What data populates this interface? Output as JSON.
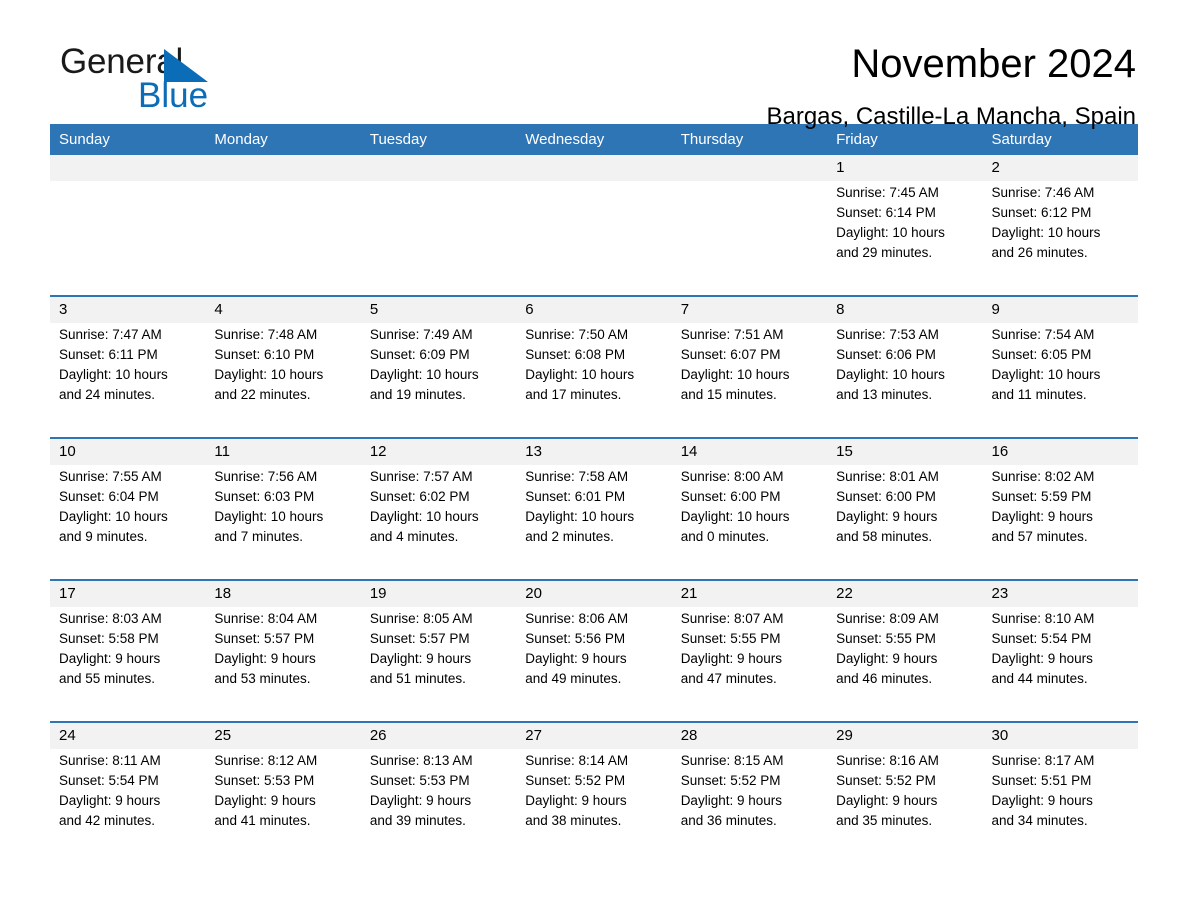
{
  "brand": {
    "name_part1": "General",
    "name_part2": "Blue",
    "triangle_icon": "triangle-icon",
    "accent_color": "#0b6cb7"
  },
  "header": {
    "title": "November 2024",
    "subtitle": "Bargas, Castille-La Mancha, Spain"
  },
  "theme": {
    "header_blue": "#2e75b6",
    "daynum_band": "#f2f2f2",
    "cell_background": "#ffffff"
  },
  "calendar": {
    "weekdays": [
      "Sunday",
      "Monday",
      "Tuesday",
      "Wednesday",
      "Thursday",
      "Friday",
      "Saturday"
    ],
    "weeks": [
      {
        "days": [
          {
            "num": "",
            "sunrise": "",
            "sunset": "",
            "daylight1": "",
            "daylight2": ""
          },
          {
            "num": "",
            "sunrise": "",
            "sunset": "",
            "daylight1": "",
            "daylight2": ""
          },
          {
            "num": "",
            "sunrise": "",
            "sunset": "",
            "daylight1": "",
            "daylight2": ""
          },
          {
            "num": "",
            "sunrise": "",
            "sunset": "",
            "daylight1": "",
            "daylight2": ""
          },
          {
            "num": "",
            "sunrise": "",
            "sunset": "",
            "daylight1": "",
            "daylight2": ""
          },
          {
            "num": "1",
            "sunrise": "Sunrise: 7:45 AM",
            "sunset": "Sunset: 6:14 PM",
            "daylight1": "Daylight: 10 hours",
            "daylight2": "and 29 minutes."
          },
          {
            "num": "2",
            "sunrise": "Sunrise: 7:46 AM",
            "sunset": "Sunset: 6:12 PM",
            "daylight1": "Daylight: 10 hours",
            "daylight2": "and 26 minutes."
          }
        ]
      },
      {
        "days": [
          {
            "num": "3",
            "sunrise": "Sunrise: 7:47 AM",
            "sunset": "Sunset: 6:11 PM",
            "daylight1": "Daylight: 10 hours",
            "daylight2": "and 24 minutes."
          },
          {
            "num": "4",
            "sunrise": "Sunrise: 7:48 AM",
            "sunset": "Sunset: 6:10 PM",
            "daylight1": "Daylight: 10 hours",
            "daylight2": "and 22 minutes."
          },
          {
            "num": "5",
            "sunrise": "Sunrise: 7:49 AM",
            "sunset": "Sunset: 6:09 PM",
            "daylight1": "Daylight: 10 hours",
            "daylight2": "and 19 minutes."
          },
          {
            "num": "6",
            "sunrise": "Sunrise: 7:50 AM",
            "sunset": "Sunset: 6:08 PM",
            "daylight1": "Daylight: 10 hours",
            "daylight2": "and 17 minutes."
          },
          {
            "num": "7",
            "sunrise": "Sunrise: 7:51 AM",
            "sunset": "Sunset: 6:07 PM",
            "daylight1": "Daylight: 10 hours",
            "daylight2": "and 15 minutes."
          },
          {
            "num": "8",
            "sunrise": "Sunrise: 7:53 AM",
            "sunset": "Sunset: 6:06 PM",
            "daylight1": "Daylight: 10 hours",
            "daylight2": "and 13 minutes."
          },
          {
            "num": "9",
            "sunrise": "Sunrise: 7:54 AM",
            "sunset": "Sunset: 6:05 PM",
            "daylight1": "Daylight: 10 hours",
            "daylight2": "and 11 minutes."
          }
        ]
      },
      {
        "days": [
          {
            "num": "10",
            "sunrise": "Sunrise: 7:55 AM",
            "sunset": "Sunset: 6:04 PM",
            "daylight1": "Daylight: 10 hours",
            "daylight2": "and 9 minutes."
          },
          {
            "num": "11",
            "sunrise": "Sunrise: 7:56 AM",
            "sunset": "Sunset: 6:03 PM",
            "daylight1": "Daylight: 10 hours",
            "daylight2": "and 7 minutes."
          },
          {
            "num": "12",
            "sunrise": "Sunrise: 7:57 AM",
            "sunset": "Sunset: 6:02 PM",
            "daylight1": "Daylight: 10 hours",
            "daylight2": "and 4 minutes."
          },
          {
            "num": "13",
            "sunrise": "Sunrise: 7:58 AM",
            "sunset": "Sunset: 6:01 PM",
            "daylight1": "Daylight: 10 hours",
            "daylight2": "and 2 minutes."
          },
          {
            "num": "14",
            "sunrise": "Sunrise: 8:00 AM",
            "sunset": "Sunset: 6:00 PM",
            "daylight1": "Daylight: 10 hours",
            "daylight2": "and 0 minutes."
          },
          {
            "num": "15",
            "sunrise": "Sunrise: 8:01 AM",
            "sunset": "Sunset: 6:00 PM",
            "daylight1": "Daylight: 9 hours",
            "daylight2": "and 58 minutes."
          },
          {
            "num": "16",
            "sunrise": "Sunrise: 8:02 AM",
            "sunset": "Sunset: 5:59 PM",
            "daylight1": "Daylight: 9 hours",
            "daylight2": "and 57 minutes."
          }
        ]
      },
      {
        "days": [
          {
            "num": "17",
            "sunrise": "Sunrise: 8:03 AM",
            "sunset": "Sunset: 5:58 PM",
            "daylight1": "Daylight: 9 hours",
            "daylight2": "and 55 minutes."
          },
          {
            "num": "18",
            "sunrise": "Sunrise: 8:04 AM",
            "sunset": "Sunset: 5:57 PM",
            "daylight1": "Daylight: 9 hours",
            "daylight2": "and 53 minutes."
          },
          {
            "num": "19",
            "sunrise": "Sunrise: 8:05 AM",
            "sunset": "Sunset: 5:57 PM",
            "daylight1": "Daylight: 9 hours",
            "daylight2": "and 51 minutes."
          },
          {
            "num": "20",
            "sunrise": "Sunrise: 8:06 AM",
            "sunset": "Sunset: 5:56 PM",
            "daylight1": "Daylight: 9 hours",
            "daylight2": "and 49 minutes."
          },
          {
            "num": "21",
            "sunrise": "Sunrise: 8:07 AM",
            "sunset": "Sunset: 5:55 PM",
            "daylight1": "Daylight: 9 hours",
            "daylight2": "and 47 minutes."
          },
          {
            "num": "22",
            "sunrise": "Sunrise: 8:09 AM",
            "sunset": "Sunset: 5:55 PM",
            "daylight1": "Daylight: 9 hours",
            "daylight2": "and 46 minutes."
          },
          {
            "num": "23",
            "sunrise": "Sunrise: 8:10 AM",
            "sunset": "Sunset: 5:54 PM",
            "daylight1": "Daylight: 9 hours",
            "daylight2": "and 44 minutes."
          }
        ]
      },
      {
        "days": [
          {
            "num": "24",
            "sunrise": "Sunrise: 8:11 AM",
            "sunset": "Sunset: 5:54 PM",
            "daylight1": "Daylight: 9 hours",
            "daylight2": "and 42 minutes."
          },
          {
            "num": "25",
            "sunrise": "Sunrise: 8:12 AM",
            "sunset": "Sunset: 5:53 PM",
            "daylight1": "Daylight: 9 hours",
            "daylight2": "and 41 minutes."
          },
          {
            "num": "26",
            "sunrise": "Sunrise: 8:13 AM",
            "sunset": "Sunset: 5:53 PM",
            "daylight1": "Daylight: 9 hours",
            "daylight2": "and 39 minutes."
          },
          {
            "num": "27",
            "sunrise": "Sunrise: 8:14 AM",
            "sunset": "Sunset: 5:52 PM",
            "daylight1": "Daylight: 9 hours",
            "daylight2": "and 38 minutes."
          },
          {
            "num": "28",
            "sunrise": "Sunrise: 8:15 AM",
            "sunset": "Sunset: 5:52 PM",
            "daylight1": "Daylight: 9 hours",
            "daylight2": "and 36 minutes."
          },
          {
            "num": "29",
            "sunrise": "Sunrise: 8:16 AM",
            "sunset": "Sunset: 5:52 PM",
            "daylight1": "Daylight: 9 hours",
            "daylight2": "and 35 minutes."
          },
          {
            "num": "30",
            "sunrise": "Sunrise: 8:17 AM",
            "sunset": "Sunset: 5:51 PM",
            "daylight1": "Daylight: 9 hours",
            "daylight2": "and 34 minutes."
          }
        ]
      }
    ]
  }
}
